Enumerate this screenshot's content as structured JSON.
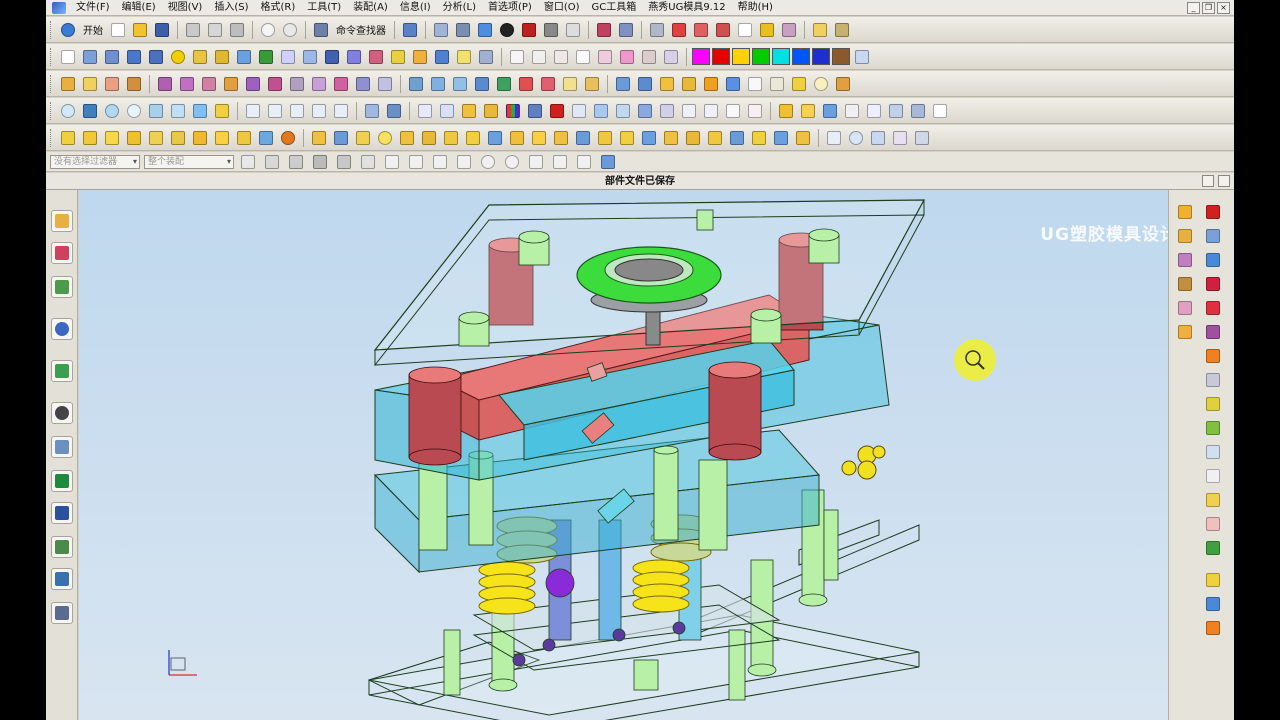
{
  "menu": {
    "items": [
      "文件(F)",
      "编辑(E)",
      "视图(V)",
      "插入(S)",
      "格式(R)",
      "工具(T)",
      "装配(A)",
      "信息(I)",
      "分析(L)",
      "首选项(P)",
      "窗口(O)",
      "GC工具箱",
      "燕秀UG模具9.12",
      "帮助(H)"
    ]
  },
  "toolbar": {
    "start_label": "开始",
    "command_finder": "命令查找器"
  },
  "selection": {
    "filter_placeholder": "没有选择过滤器",
    "scope_placeholder": "整个装配"
  },
  "status": {
    "message": "部件文件已保存"
  },
  "watermark": "UG塑胶模具设计",
  "colors": {
    "swatches": [
      "#ff00ff",
      "#e60000",
      "#ffd100",
      "#00cc00",
      "#00e0e0",
      "#0055ff",
      "#1e2fd0",
      "#8b5a2b"
    ],
    "viewport_top": "#bfd8ee",
    "mold_cyan": "#39c6e0",
    "mold_red": "#d96565",
    "mold_green": "#b8f0a8",
    "spring_yellow": "#f7e31a",
    "ring_green": "#3ddc3d",
    "zoom_cursor": "#f0f02a"
  },
  "icons": {
    "left_bar": [
      "assembly-nav-icon",
      "constraint-nav-icon",
      "part-nav-icon",
      "reuse-library-icon",
      "web-browser-icon",
      "history-icon",
      "system-materials-icon",
      "process-studio-icon",
      "manufacturing-wizard-icon",
      "roles-icon",
      "system-scenes-icon",
      "palette-icon"
    ],
    "right_bar": [
      "mold-wizard-init-icon",
      "mold-csys-icon",
      "shrinkage-icon",
      "workpiece-icon",
      "cavity-layout-icon",
      "family-mold-icon",
      "mold-tools-icon",
      "parting-icon",
      "mold-base-icon",
      "standard-parts-icon",
      "ejector-pin-icon",
      "trim-ejector-icon",
      "slider-lifter-icon",
      "sub-insert-icon",
      "gate-icon",
      "runner-icon",
      "cooling-icon",
      "electrode-icon",
      "bom-icon",
      "drawing-icon",
      "hole-table-icon",
      "view-manager-icon",
      "delete-files-icon",
      "check-icon"
    ]
  }
}
